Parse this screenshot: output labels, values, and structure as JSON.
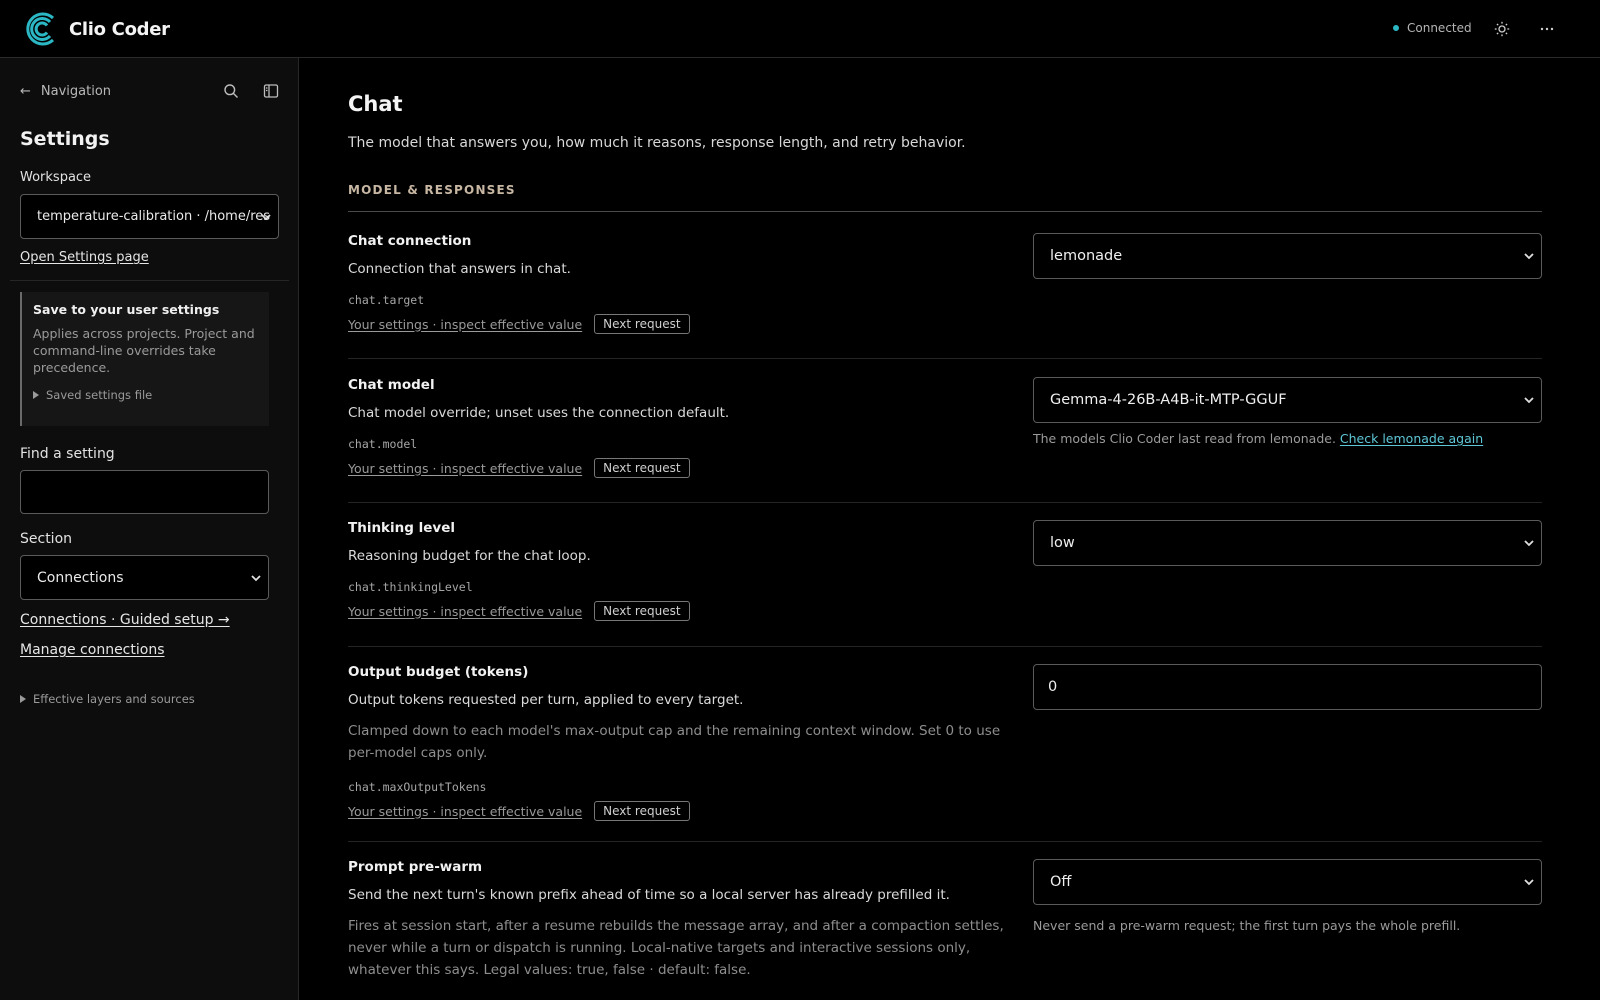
{
  "header": {
    "app_name": "Clio Coder",
    "status_label": "Connected",
    "status_color": "#2bb7c4",
    "theme_icon": "sun-icon",
    "menu_icon": "more-horizontal-icon"
  },
  "sidebar": {
    "nav_back_label": "Navigation",
    "search_icon": "search-icon",
    "panel_icon": "sidebar-toggle-icon",
    "title": "Settings",
    "workspace_label": "Workspace",
    "workspace_value": "temperature-calibration · /home/res",
    "open_settings_link": "Open Settings page",
    "note": {
      "title": "Save to your user settings",
      "body": "Applies across projects. Project and command-line overrides take precedence.",
      "disclosure": "Saved settings file"
    },
    "find_label": "Find a setting",
    "find_value": "",
    "section_label": "Section",
    "section_value": "Connections",
    "guided_setup_link": "Connections · Guided setup →",
    "manage_connections_link": "Manage connections",
    "layers_disclosure": "Effective layers and sources"
  },
  "main": {
    "title": "Chat",
    "description": "The model that answers you, how much it reasons, response length, and retry behavior.",
    "section_heading": "MODEL & RESPONSES",
    "settings": [
      {
        "title": "Chat connection",
        "desc": "Connection that answers in chat.",
        "key": "chat.target",
        "link": "Your settings · inspect effective value",
        "badge": "Next request",
        "control_value": "lemonade"
      },
      {
        "title": "Chat model",
        "desc": "Chat model override; unset uses the connection default.",
        "key": "chat.model",
        "link": "Your settings · inspect effective value",
        "badge": "Next request",
        "control_value": "Gemma-4-26B-A4B-it-MTP-GGUF",
        "help": "The models Clio Coder last read from lemonade.",
        "help_link": "Check lemonade again"
      },
      {
        "title": "Thinking level",
        "desc": "Reasoning budget for the chat loop.",
        "key": "chat.thinkingLevel",
        "link": "Your settings · inspect effective value",
        "badge": "Next request",
        "control_value": "low"
      },
      {
        "title": "Output budget (tokens)",
        "desc": "Output tokens requested per turn, applied to every target.",
        "extra": "Clamped down to each model's max-output cap and the remaining context window. Set 0 to use per-model caps only.",
        "key": "chat.maxOutputTokens",
        "link": "Your settings · inspect effective value",
        "badge": "Next request",
        "control_value": "0"
      },
      {
        "title": "Prompt pre-warm",
        "desc": "Send the next turn's known prefix ahead of time so a local server has already prefilled it.",
        "extra": "Fires at session start, after a resume rebuilds the message array, and after a compaction settles, never while a turn or dispatch is running. Local-native targets and interactive sessions only, whatever this says. Legal values: true, false · default: false.",
        "control_value": "Off",
        "help": "Never send a pre-warm request; the first turn pays the whole prefill."
      }
    ]
  }
}
